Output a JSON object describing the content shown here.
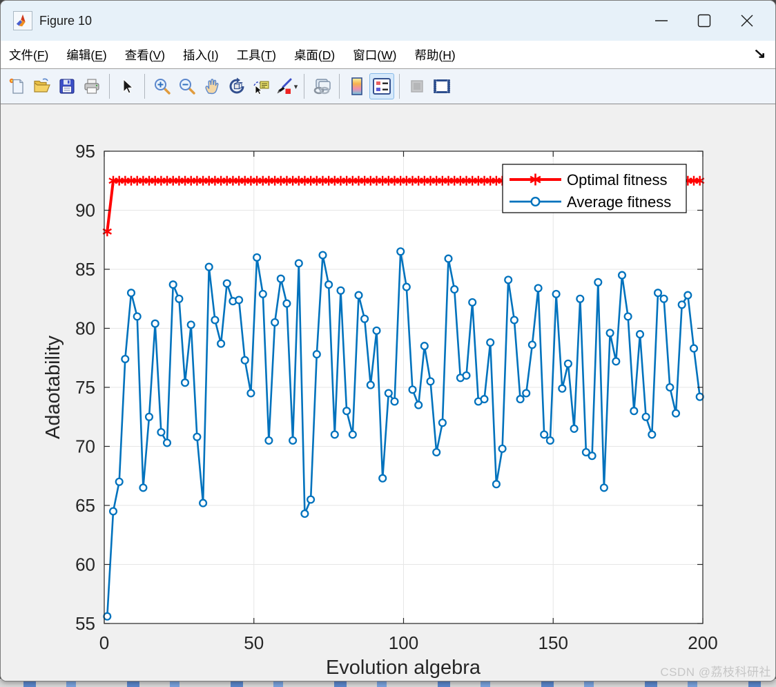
{
  "window": {
    "title": "Figure 10",
    "controls": {
      "minimize": "minimize",
      "maximize": "maximize",
      "close": "close"
    }
  },
  "menu": {
    "items": [
      {
        "id": "file",
        "pre": "文件(",
        "key": "F",
        "post": ")"
      },
      {
        "id": "edit",
        "pre": "编辑(",
        "key": "E",
        "post": ")"
      },
      {
        "id": "view",
        "pre": "查看(",
        "key": "V",
        "post": ")"
      },
      {
        "id": "insert",
        "pre": "插入(",
        "key": "I",
        "post": ")"
      },
      {
        "id": "tools",
        "pre": "工具(",
        "key": "T",
        "post": ")"
      },
      {
        "id": "desktop",
        "pre": "桌面(",
        "key": "D",
        "post": ")"
      },
      {
        "id": "window",
        "pre": "窗口(",
        "key": "W",
        "post": ")"
      },
      {
        "id": "help",
        "pre": "帮助(",
        "key": "H",
        "post": ")"
      }
    ],
    "dock_arrow_glyph": "↘"
  },
  "toolbar": {
    "buttons": [
      {
        "name": "new-figure",
        "enabled": true,
        "active": false
      },
      {
        "name": "open-file",
        "enabled": true,
        "active": false
      },
      {
        "name": "save-figure",
        "enabled": true,
        "active": false
      },
      {
        "name": "print-figure",
        "enabled": true,
        "active": false
      },
      {
        "name": "pointer",
        "enabled": true,
        "active": false
      },
      {
        "name": "zoom-in",
        "enabled": true,
        "active": false
      },
      {
        "name": "zoom-out",
        "enabled": true,
        "active": false
      },
      {
        "name": "pan",
        "enabled": true,
        "active": false
      },
      {
        "name": "rotate-3d",
        "enabled": true,
        "active": false
      },
      {
        "name": "data-cursor",
        "enabled": true,
        "active": false
      },
      {
        "name": "brush",
        "enabled": true,
        "active": false
      },
      {
        "name": "link-plot",
        "enabled": true,
        "active": false
      },
      {
        "name": "insert-colorbar",
        "enabled": true,
        "active": false
      },
      {
        "name": "insert-legend",
        "enabled": true,
        "active": true
      },
      {
        "name": "hide-plot-tools",
        "enabled": false,
        "active": false
      },
      {
        "name": "show-plot-tools-dock",
        "enabled": true,
        "active": false
      }
    ]
  },
  "colors": {
    "optimal_red": "#FF0000",
    "average_blue": "#0072BD",
    "grid": "#E6E6E6",
    "axis_text": "#262626",
    "watermark": "#C6C6C6"
  },
  "watermark": "CSDN @荔枝科研社",
  "chart_data": {
    "type": "line",
    "title": "",
    "xlabel": "Evolution algebra",
    "ylabel": "Adaotability",
    "xlim": [
      0,
      200
    ],
    "ylim": [
      55,
      95
    ],
    "xticks": [
      0,
      50,
      100,
      150,
      200
    ],
    "yticks": [
      55,
      60,
      65,
      70,
      75,
      80,
      85,
      90,
      95
    ],
    "grid": true,
    "legend": {
      "position": "northeast",
      "entries": [
        {
          "label": "Optimal fitness",
          "color": "#FF0000",
          "marker": "asterisk"
        },
        {
          "label": "Average fitness",
          "color": "#0072BD",
          "marker": "circle"
        }
      ]
    },
    "series": [
      {
        "name": "Optimal fitness",
        "color": "#FF0000",
        "marker": "asterisk",
        "line_width": 4,
        "x": [
          1,
          3,
          5,
          7,
          9,
          11,
          13,
          15,
          17,
          19,
          21,
          23,
          25,
          27,
          29,
          31,
          33,
          35,
          37,
          39,
          41,
          43,
          45,
          47,
          49,
          51,
          53,
          55,
          57,
          59,
          61,
          63,
          65,
          67,
          69,
          71,
          73,
          75,
          77,
          79,
          81,
          83,
          85,
          87,
          89,
          91,
          93,
          95,
          97,
          99,
          101,
          103,
          105,
          107,
          109,
          111,
          113,
          115,
          117,
          119,
          121,
          123,
          125,
          127,
          129,
          131,
          133,
          135,
          137,
          139,
          141,
          143,
          145,
          147,
          149,
          151,
          153,
          155,
          157,
          159,
          161,
          163,
          165,
          167,
          169,
          171,
          173,
          175,
          177,
          179,
          181,
          183,
          185,
          187,
          189,
          191,
          193,
          195,
          197,
          199
        ],
        "y": [
          88.2,
          92.5,
          92.5,
          92.5,
          92.5,
          92.5,
          92.5,
          92.5,
          92.5,
          92.5,
          92.5,
          92.5,
          92.5,
          92.5,
          92.5,
          92.5,
          92.5,
          92.5,
          92.5,
          92.5,
          92.5,
          92.5,
          92.5,
          92.5,
          92.5,
          92.5,
          92.5,
          92.5,
          92.5,
          92.5,
          92.5,
          92.5,
          92.5,
          92.5,
          92.5,
          92.5,
          92.5,
          92.5,
          92.5,
          92.5,
          92.5,
          92.5,
          92.5,
          92.5,
          92.5,
          92.5,
          92.5,
          92.5,
          92.5,
          92.5,
          92.5,
          92.5,
          92.5,
          92.5,
          92.5,
          92.5,
          92.5,
          92.5,
          92.5,
          92.5,
          92.5,
          92.5,
          92.5,
          92.5,
          92.5,
          92.5,
          92.5,
          92.5,
          92.5,
          92.5,
          92.5,
          92.5,
          92.5,
          92.5,
          92.5,
          92.5,
          92.5,
          92.5,
          92.5,
          92.5,
          92.5,
          92.5,
          92.5,
          92.5,
          92.5,
          92.5,
          92.5,
          92.5,
          92.5,
          92.5,
          92.5,
          92.5,
          92.5,
          92.5,
          92.5,
          92.5,
          92.5,
          92.5,
          92.5,
          92.5
        ]
      },
      {
        "name": "Average fitness",
        "color": "#0072BD",
        "marker": "circle",
        "line_width": 2.6,
        "x": [
          1,
          3,
          5,
          7,
          9,
          11,
          13,
          15,
          17,
          19,
          21,
          23,
          25,
          27,
          29,
          31,
          33,
          35,
          37,
          39,
          41,
          43,
          45,
          47,
          49,
          51,
          53,
          55,
          57,
          59,
          61,
          63,
          65,
          67,
          69,
          71,
          73,
          75,
          77,
          79,
          81,
          83,
          85,
          87,
          89,
          91,
          93,
          95,
          97,
          99,
          101,
          103,
          105,
          107,
          109,
          111,
          113,
          115,
          117,
          119,
          121,
          123,
          125,
          127,
          129,
          131,
          133,
          135,
          137,
          139,
          141,
          143,
          145,
          147,
          149,
          151,
          153,
          155,
          157,
          159,
          161,
          163,
          165,
          167,
          169,
          171,
          173,
          175,
          177,
          179,
          181,
          183,
          185,
          187,
          189,
          191,
          193,
          195,
          197,
          199
        ],
        "y": [
          55.6,
          64.5,
          67.0,
          77.4,
          83.0,
          81.0,
          66.5,
          72.5,
          80.4,
          71.2,
          70.3,
          83.7,
          82.5,
          75.4,
          80.3,
          70.8,
          65.2,
          85.2,
          80.7,
          78.7,
          83.8,
          82.3,
          82.4,
          77.3,
          74.5,
          86.0,
          82.9,
          70.5,
          80.5,
          84.2,
          82.1,
          70.5,
          85.5,
          64.3,
          65.5,
          77.8,
          86.2,
          83.7,
          71.0,
          83.2,
          73.0,
          71.0,
          82.8,
          80.8,
          75.2,
          79.8,
          67.3,
          74.5,
          73.8,
          86.5,
          83.5,
          74.8,
          73.5,
          78.5,
          75.5,
          69.5,
          72.0,
          85.9,
          83.3,
          75.8,
          76.0,
          82.2,
          73.8,
          74.0,
          78.8,
          66.8,
          69.8,
          84.1,
          80.7,
          74.0,
          74.5,
          78.6,
          83.4,
          71.0,
          70.5,
          82.9,
          74.9,
          77.0,
          71.5,
          82.5,
          69.5,
          69.2,
          83.9,
          66.5,
          79.6,
          77.2,
          84.5,
          81.0,
          73.0,
          79.5,
          72.5,
          71.0,
          83.0,
          82.5,
          75.0,
          72.8,
          82.0,
          82.8,
          78.3,
          74.2
        ]
      }
    ]
  }
}
